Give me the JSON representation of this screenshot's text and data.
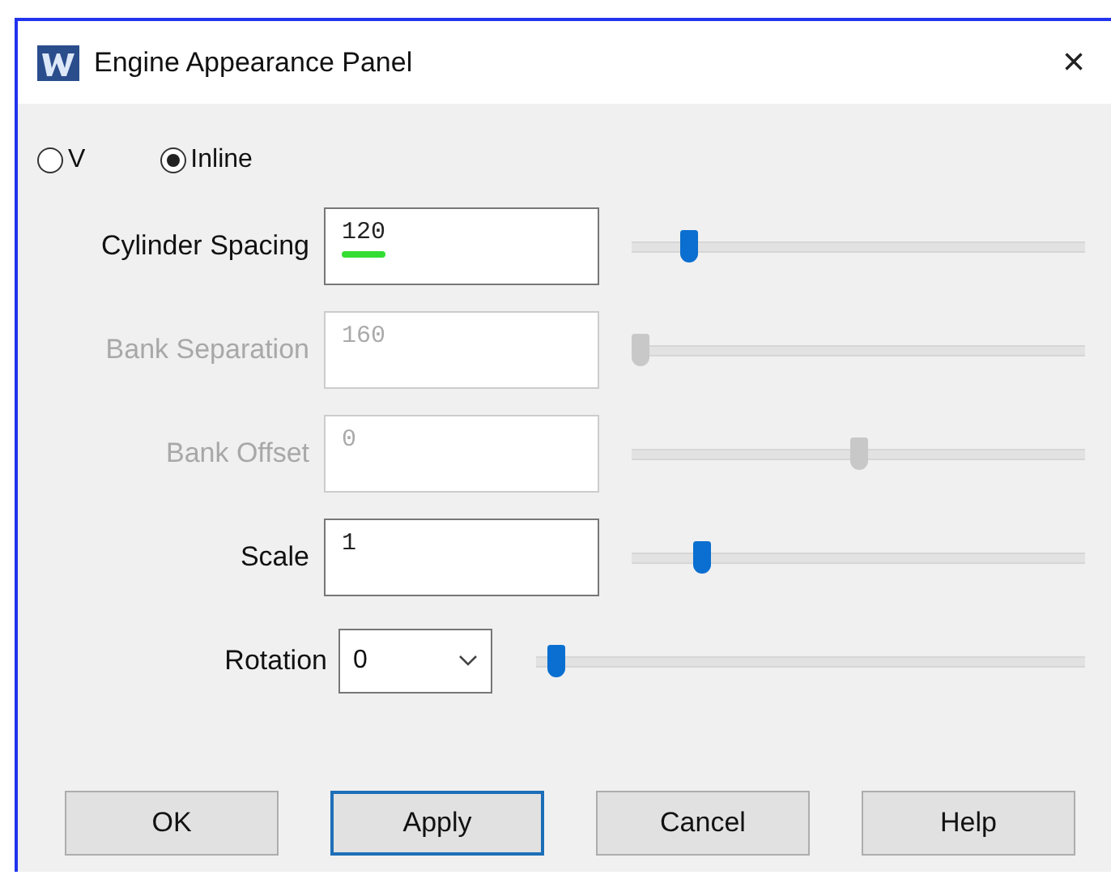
{
  "window": {
    "title": "Engine Appearance Panel",
    "close": "×"
  },
  "layout_options": [
    {
      "label": "V",
      "selected": false
    },
    {
      "label": "Inline",
      "selected": true
    }
  ],
  "rows": [
    {
      "kind": "field",
      "label": "Cylinder Spacing",
      "value": "120",
      "disabled": false,
      "underlined": true,
      "level": 0.11
    },
    {
      "kind": "field",
      "label": "Bank Separation",
      "value": "160",
      "disabled": true,
      "underlined": false,
      "level": 0
    },
    {
      "kind": "field",
      "label": "Bank Offset",
      "value": "0",
      "disabled": true,
      "underlined": false,
      "level": 0.5
    },
    {
      "kind": "field",
      "label": "Scale",
      "value": "1",
      "disabled": false,
      "underlined": false,
      "level": 0.14
    },
    {
      "kind": "select",
      "label": "Rotation",
      "value": "0",
      "level": 0.02
    }
  ],
  "buttons": [
    {
      "label": "OK",
      "focused": false
    },
    {
      "label": "Apply",
      "focused": true
    },
    {
      "label": "Cancel",
      "focused": false
    },
    {
      "label": "Help",
      "focused": false
    }
  ]
}
